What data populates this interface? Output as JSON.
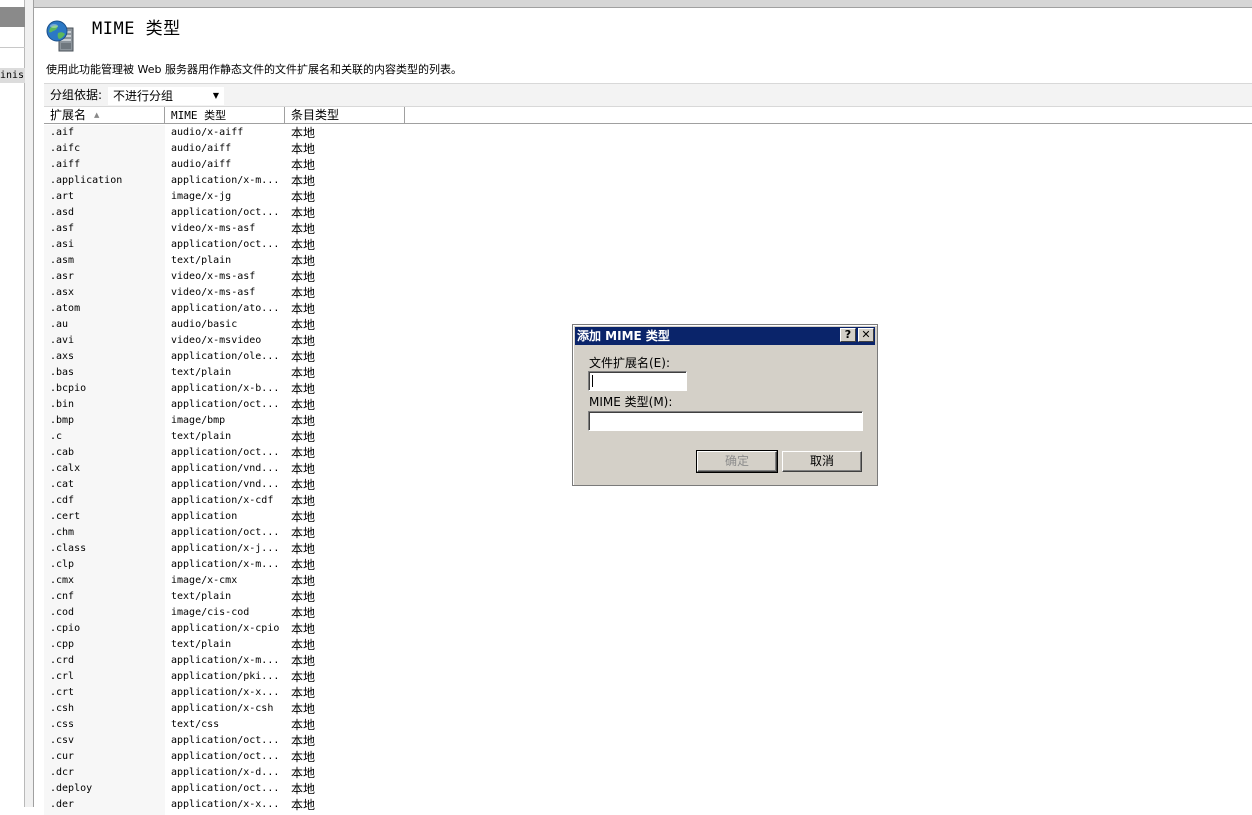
{
  "left_pane": {
    "node_label": "inis"
  },
  "page": {
    "title": "MIME 类型",
    "description": "使用此功能管理被 Web 服务器用作静态文件的文件扩展名和关联的内容类型的列表。"
  },
  "groupby": {
    "label": "分组依据:",
    "value": "不进行分组"
  },
  "table": {
    "columns": [
      "扩展名",
      "MIME 类型",
      "条目类型"
    ],
    "sort_column": "扩展名",
    "rows": [
      [
        ".aif",
        "audio/x-aiff",
        "本地"
      ],
      [
        ".aifc",
        "audio/aiff",
        "本地"
      ],
      [
        ".aiff",
        "audio/aiff",
        "本地"
      ],
      [
        ".application",
        "application/x-m...",
        "本地"
      ],
      [
        ".art",
        "image/x-jg",
        "本地"
      ],
      [
        ".asd",
        "application/oct...",
        "本地"
      ],
      [
        ".asf",
        "video/x-ms-asf",
        "本地"
      ],
      [
        ".asi",
        "application/oct...",
        "本地"
      ],
      [
        ".asm",
        "text/plain",
        "本地"
      ],
      [
        ".asr",
        "video/x-ms-asf",
        "本地"
      ],
      [
        ".asx",
        "video/x-ms-asf",
        "本地"
      ],
      [
        ".atom",
        "application/ato...",
        "本地"
      ],
      [
        ".au",
        "audio/basic",
        "本地"
      ],
      [
        ".avi",
        "video/x-msvideo",
        "本地"
      ],
      [
        ".axs",
        "application/ole...",
        "本地"
      ],
      [
        ".bas",
        "text/plain",
        "本地"
      ],
      [
        ".bcpio",
        "application/x-b...",
        "本地"
      ],
      [
        ".bin",
        "application/oct...",
        "本地"
      ],
      [
        ".bmp",
        "image/bmp",
        "本地"
      ],
      [
        ".c",
        "text/plain",
        "本地"
      ],
      [
        ".cab",
        "application/oct...",
        "本地"
      ],
      [
        ".calx",
        "application/vnd...",
        "本地"
      ],
      [
        ".cat",
        "application/vnd...",
        "本地"
      ],
      [
        ".cdf",
        "application/x-cdf",
        "本地"
      ],
      [
        ".cert",
        "application",
        "本地"
      ],
      [
        ".chm",
        "application/oct...",
        "本地"
      ],
      [
        ".class",
        "application/x-j...",
        "本地"
      ],
      [
        ".clp",
        "application/x-m...",
        "本地"
      ],
      [
        ".cmx",
        "image/x-cmx",
        "本地"
      ],
      [
        ".cnf",
        "text/plain",
        "本地"
      ],
      [
        ".cod",
        "image/cis-cod",
        "本地"
      ],
      [
        ".cpio",
        "application/x-cpio",
        "本地"
      ],
      [
        ".cpp",
        "text/plain",
        "本地"
      ],
      [
        ".crd",
        "application/x-m...",
        "本地"
      ],
      [
        ".crl",
        "application/pki...",
        "本地"
      ],
      [
        ".crt",
        "application/x-x...",
        "本地"
      ],
      [
        ".csh",
        "application/x-csh",
        "本地"
      ],
      [
        ".css",
        "text/css",
        "本地"
      ],
      [
        ".csv",
        "application/oct...",
        "本地"
      ],
      [
        ".cur",
        "application/oct...",
        "本地"
      ],
      [
        ".dcr",
        "application/x-d...",
        "本地"
      ],
      [
        ".deploy",
        "application/oct...",
        "本地"
      ],
      [
        ".der",
        "application/x-x...",
        "本地"
      ]
    ]
  },
  "dialog": {
    "title": "添加 MIME 类型",
    "help_glyph": "?",
    "close_glyph": "✕",
    "ext_label": "文件扩展名(E):",
    "ext_value": "",
    "mime_label": "MIME 类型(M):",
    "mime_value": "",
    "ok_label": "确定",
    "cancel_label": "取消"
  },
  "icons": {
    "header": "globe-server-icon",
    "dropdown": "dropdown-arrow-icon",
    "sort": "sort-ascending-icon"
  },
  "colors": {
    "dialog_title_bg": "#0a246a",
    "dialog_face": "#d4d0c8",
    "extension_column_bg": "#f7f7f7"
  }
}
